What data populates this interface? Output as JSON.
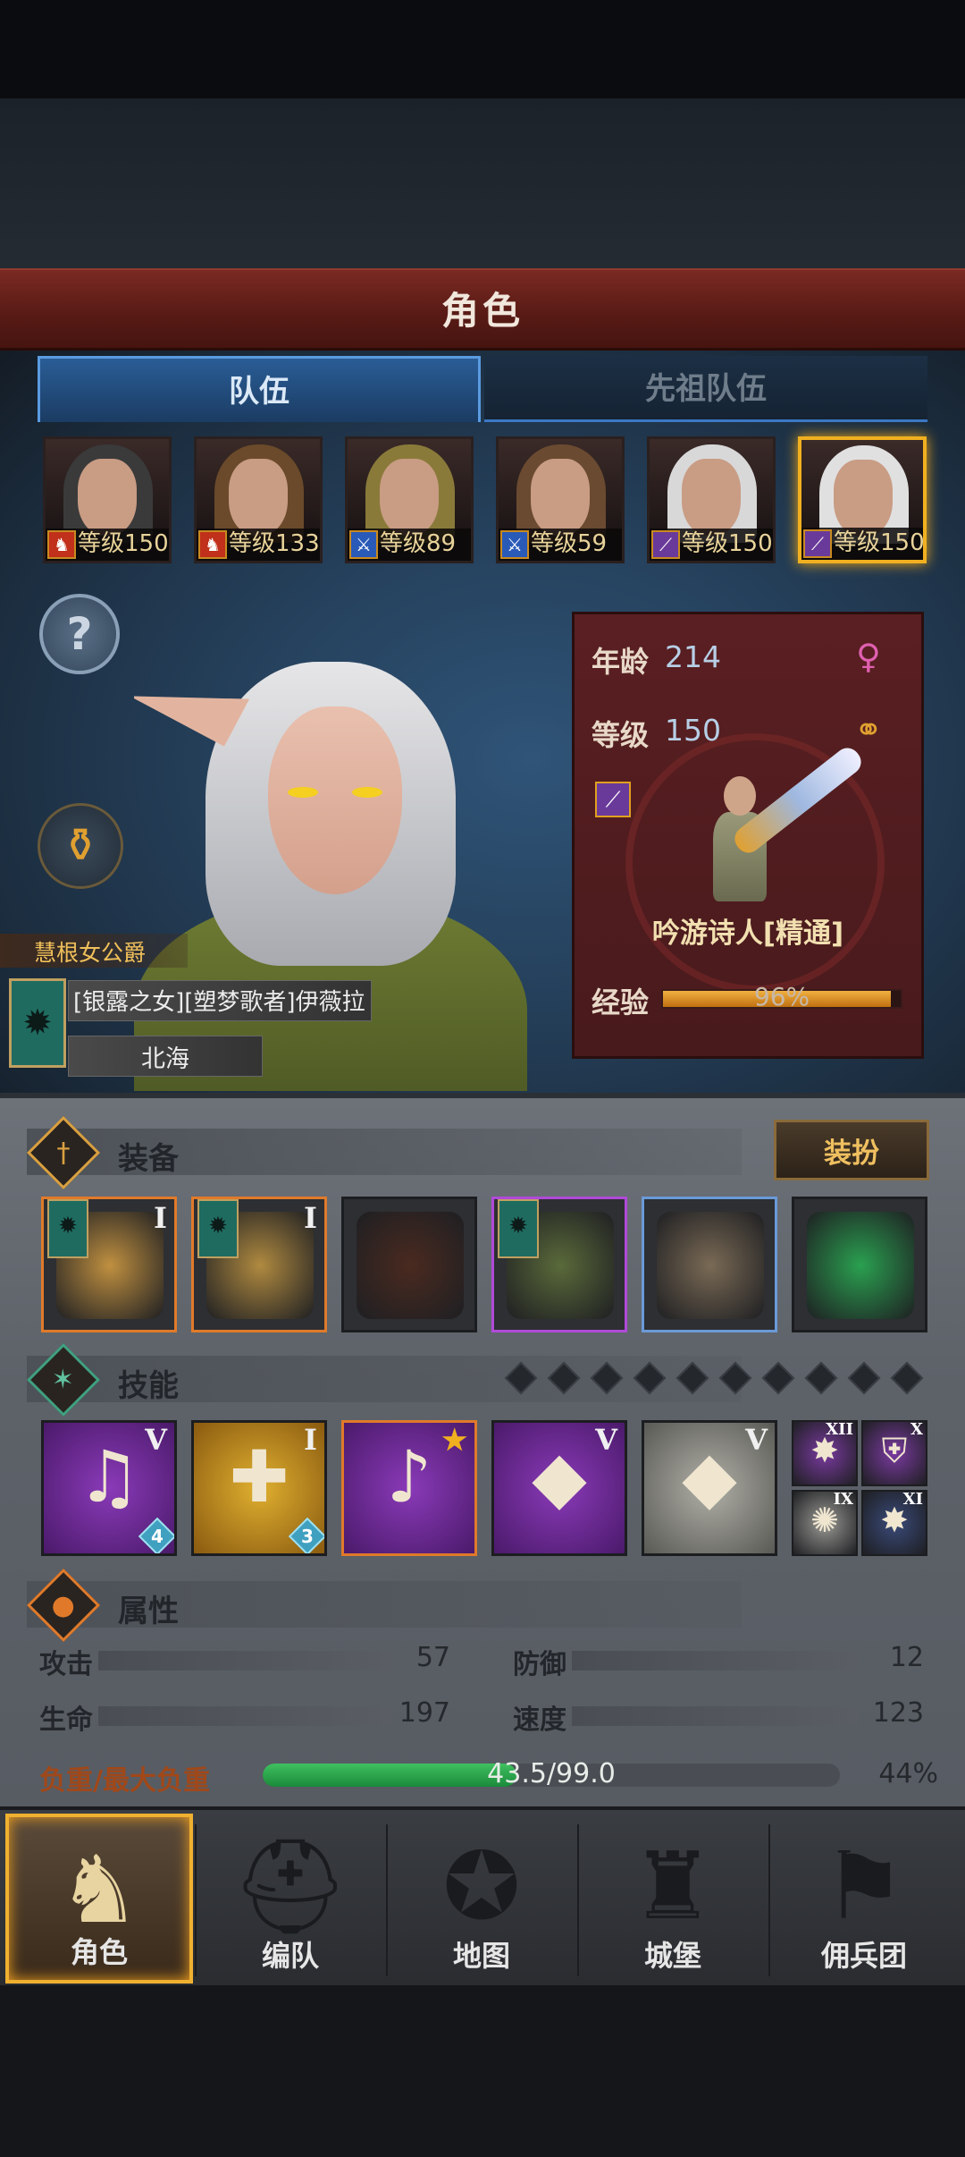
{
  "header": {
    "title": "角色"
  },
  "tabs": [
    {
      "label": "队伍",
      "active": true
    },
    {
      "label": "先祖队伍",
      "active": false
    }
  ],
  "roster": [
    {
      "level": "等级150",
      "class_icon": "horse-icon",
      "hair": "#3a3a3a",
      "selected": false
    },
    {
      "level": "等级133",
      "class_icon": "horse-icon",
      "hair": "#6a4a2a",
      "selected": false
    },
    {
      "level": "等级89",
      "class_icon": "sword-icon",
      "hair": "#8a7a3a",
      "selected": false
    },
    {
      "level": "等级59",
      "class_icon": "sword-icon",
      "hair": "#6a4a30",
      "selected": false
    },
    {
      "level": "等级150",
      "class_icon": "staff-icon",
      "hair": "#d8d8d8",
      "selected": false
    },
    {
      "level": "等级150",
      "class_icon": "staff-icon",
      "hair": "#e0e0e0",
      "selected": true
    }
  ],
  "character": {
    "title": "慧根女公爵",
    "name": "[银露之女][塑梦歌者]伊薇拉",
    "region": "北海",
    "age_label": "年龄",
    "age": "214",
    "level_label": "等级",
    "level": "150",
    "class_name": "吟游诗人[精通]",
    "exp_label": "经验",
    "exp_text": "96%",
    "exp_fraction": 0.96
  },
  "equipment": {
    "title": "装备",
    "dressup_label": "装扮",
    "items": [
      {
        "name": "lute-weapon",
        "tier": "I",
        "flag": true,
        "rarity": "orange",
        "color": "#c09040"
      },
      {
        "name": "lute-weapon",
        "tier": "I",
        "flag": true,
        "rarity": "orange",
        "color": "#b08a40"
      },
      {
        "name": "hood",
        "tier": "",
        "flag": false,
        "rarity": "none",
        "color": "#4a2a20"
      },
      {
        "name": "cloak-armor",
        "tier": "",
        "flag": true,
        "rarity": "purple",
        "color": "#5a6a3a"
      },
      {
        "name": "boots",
        "tier": "",
        "flag": false,
        "rarity": "blue",
        "color": "#7a6a55"
      },
      {
        "name": "green-crystal",
        "tier": "",
        "flag": false,
        "rarity": "none",
        "color": "#2aa050"
      }
    ]
  },
  "skills": {
    "title": "技能",
    "pip_count": 10,
    "slots": [
      {
        "glyph": "♫",
        "tier": "V",
        "count": "4",
        "bg": "purple"
      },
      {
        "glyph": "✚",
        "tier": "I",
        "count": "3",
        "bg": "gold"
      },
      {
        "glyph": "♪",
        "tier": "★",
        "count": "",
        "bg": "purple-sel"
      },
      {
        "glyph": "◆",
        "tier": "V",
        "count": "",
        "bg": "purple"
      },
      {
        "glyph": "◆",
        "tier": "V",
        "count": "",
        "bg": "grey"
      }
    ],
    "mini": [
      {
        "glyph": "✸",
        "tier": "XII",
        "color": "#7a3aa0"
      },
      {
        "glyph": "⛨",
        "tier": "X",
        "color": "#7a3aa0"
      },
      {
        "glyph": "✺",
        "tier": "IX",
        "color": "#9a9a95"
      },
      {
        "glyph": "✸",
        "tier": "XI",
        "color": "#3a4a7a"
      }
    ]
  },
  "attributes": {
    "title": "属性",
    "stats": [
      {
        "label": "攻击",
        "value": "57"
      },
      {
        "label": "防御",
        "value": "12"
      },
      {
        "label": "生命",
        "value": "197"
      },
      {
        "label": "速度",
        "value": "123"
      }
    ],
    "load_label": "负重/最大负重",
    "load_text": "43.5/99.0",
    "load_pct": "44%",
    "load_fraction": 0.44
  },
  "nav": [
    {
      "label": "角色",
      "icon": "knight-icon",
      "active": true
    },
    {
      "label": "编队",
      "icon": "helmet-icon",
      "active": false
    },
    {
      "label": "地图",
      "icon": "compass-icon",
      "active": false
    },
    {
      "label": "城堡",
      "icon": "castle-icon",
      "active": false
    },
    {
      "label": "佣兵团",
      "icon": "banner-icon",
      "active": false
    }
  ],
  "colors": {
    "accent": "#f0b020",
    "header": "#5a1b16",
    "panel": "#481a1c"
  }
}
